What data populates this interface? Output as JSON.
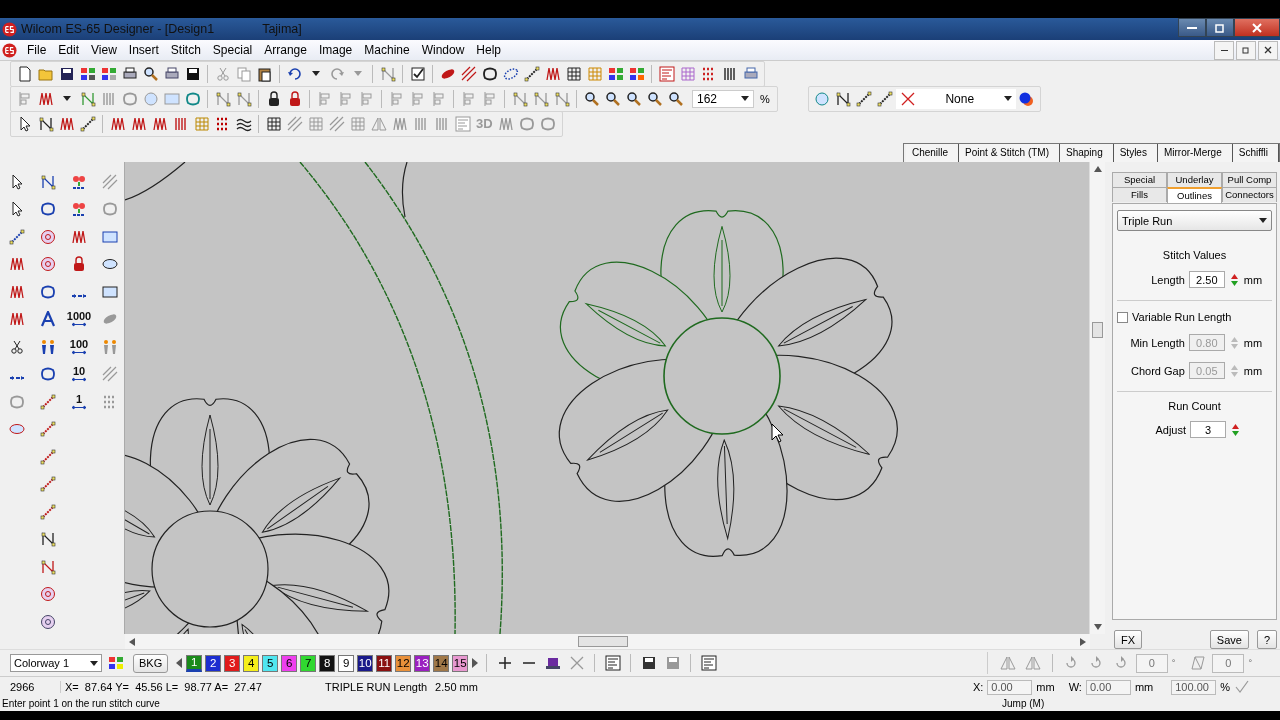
{
  "window": {
    "title": "Wilcom ES-65 Designer - [Design1",
    "title_suffix": "Tajima]"
  },
  "menu": [
    "File",
    "Edit",
    "View",
    "Insert",
    "Stitch",
    "Special",
    "Arrange",
    "Image",
    "Machine",
    "Window",
    "Help"
  ],
  "zoom": {
    "value": "162",
    "unit": "%"
  },
  "object_filter": {
    "value": "None"
  },
  "stitch_toolbar": {
    "label_3d": "3D"
  },
  "tool_tabs": [
    "Chenille",
    "Point & Stitch (TM)",
    "Shaping",
    "Styles",
    "Mirror-Merge",
    "Schiffli"
  ],
  "toolbox": {
    "step_labels": [
      "1000",
      "100",
      "10",
      "1"
    ]
  },
  "property_tabs": [
    [
      {
        "label": "Special",
        "selected": false
      },
      {
        "label": "Underlay",
        "selected": false
      },
      {
        "label": "Pull Comp",
        "selected": false
      }
    ],
    [
      {
        "label": "Fills",
        "selected": false
      },
      {
        "label": "Outlines",
        "selected": true
      },
      {
        "label": "Connectors",
        "selected": false
      }
    ]
  ],
  "stitch_type": "Triple Run",
  "stitch_values": {
    "heading": "Stitch Values",
    "label": "Length",
    "value": "2.50",
    "unit": "mm"
  },
  "variable_run_length": {
    "label": "Variable Run Length",
    "checked": false
  },
  "fields": [
    {
      "label": "Min Length",
      "value": "0.80",
      "unit": "mm",
      "disabled": true
    },
    {
      "label": "Chord Gap",
      "value": "0.05",
      "unit": "mm",
      "disabled": true
    }
  ],
  "run_count": {
    "heading": "Run Count",
    "label": "Adjust",
    "value": "3"
  },
  "panel_buttons": {
    "fx": "FX",
    "save": "Save",
    "help": "?"
  },
  "colorway": "Colorway 1",
  "background_button": "BKG",
  "colors": [
    {
      "label": "1",
      "color": "#1a8a1a",
      "selected": true
    },
    {
      "label": "2",
      "color": "#1c2ed0",
      "selected": false
    },
    {
      "label": "3",
      "color": "#e01b1b",
      "selected": false
    },
    {
      "label": "4",
      "color": "#f5ee1a",
      "selected": false
    },
    {
      "label": "5",
      "color": "#50e6f0",
      "selected": false
    },
    {
      "label": "6",
      "color": "#ee40ee",
      "selected": false
    },
    {
      "label": "7",
      "color": "#30d830",
      "selected": false
    },
    {
      "label": "8",
      "color": "#111111",
      "selected": false
    },
    {
      "label": "9",
      "color": "#ffffff",
      "selected": false
    },
    {
      "label": "10",
      "color": "#1a1a8a",
      "selected": false
    },
    {
      "label": "11",
      "color": "#8a1010",
      "selected": false
    },
    {
      "label": "12",
      "color": "#e8903a",
      "selected": false
    },
    {
      "label": "13",
      "color": "#9a20c0",
      "selected": false
    },
    {
      "label": "14",
      "color": "#a07848",
      "selected": false
    },
    {
      "label": "15",
      "color": "#e898d0",
      "selected": false
    }
  ],
  "transform": {
    "rotation": "0",
    "rotation_unit": "°",
    "slant": "0",
    "slant_unit": "°"
  },
  "status": {
    "stitch_count": "2966",
    "coordinates": "X=  87.64 Y=  45.56 L=  98.77 A=  27.47",
    "object": "TRIPLE RUN Length",
    "object_value": "2.50 mm",
    "prompt": "Enter point 1 on the run stitch curve",
    "mode": "Jump (M)"
  },
  "position": {
    "x_label": "X:",
    "x_value": "0.00",
    "x_unit": "mm",
    "w_label": "W:",
    "w_value": "0.00",
    "w_unit": "mm",
    "scale_value": "100.00",
    "scale_unit": "%"
  }
}
